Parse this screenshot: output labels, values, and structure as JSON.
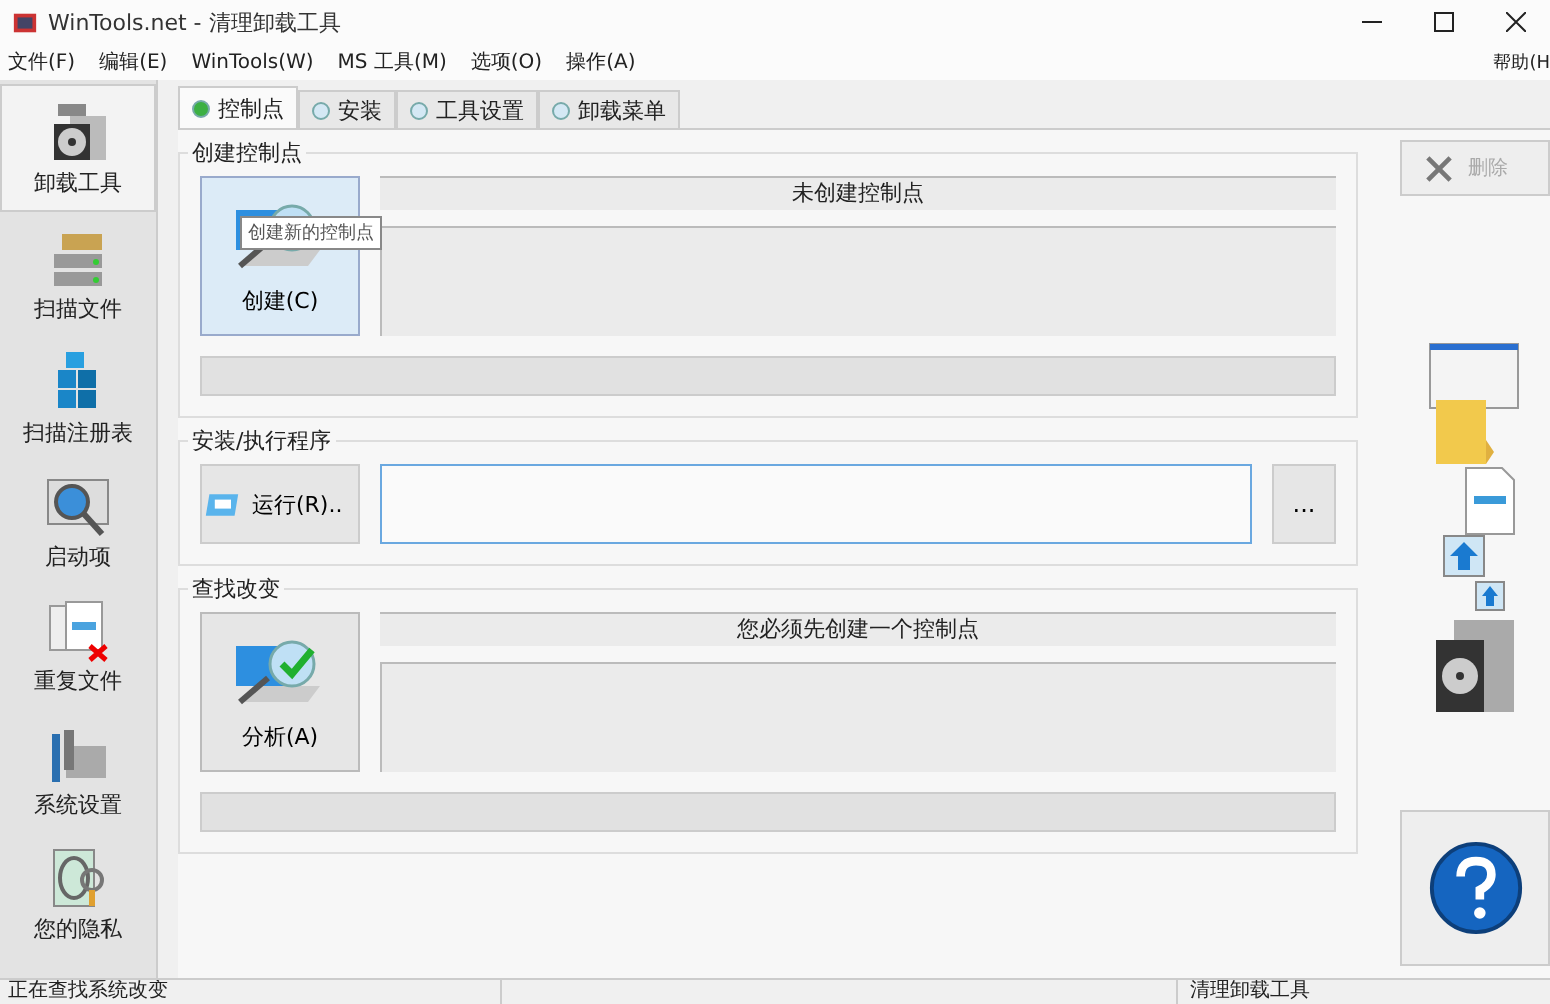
{
  "window": {
    "title": "WinTools.net - 清理卸载工具"
  },
  "menu": [
    {
      "label": "文件(F)"
    },
    {
      "label": "编辑(E)"
    },
    {
      "label": "WinTools(W)"
    },
    {
      "label": "MS 工具(M)"
    },
    {
      "label": "选项(O)"
    },
    {
      "label": "操作(A)"
    }
  ],
  "help_menu": "帮助(H",
  "tabs": [
    {
      "label": "控制点",
      "selected": true
    },
    {
      "label": "安装",
      "selected": false
    },
    {
      "label": "工具设置",
      "selected": false
    },
    {
      "label": "卸载菜单",
      "selected": false
    }
  ],
  "sidebar": {
    "items": [
      {
        "label": "卸载工具",
        "selected": true
      },
      {
        "label": "扫描文件",
        "selected": false
      },
      {
        "label": "扫描注册表",
        "selected": false
      },
      {
        "label": "启动项",
        "selected": false
      },
      {
        "label": "重复文件",
        "selected": false
      },
      {
        "label": "系统设置",
        "selected": false
      },
      {
        "label": "您的隐私",
        "selected": false
      }
    ]
  },
  "sections": [
    {
      "kind": "status",
      "title": "创建控制点",
      "button": "创建(C)",
      "highlighted": true,
      "check": false,
      "status": "未创建控制点",
      "tooltip": "创建新的控制点",
      "progress": {
        "level": 0
      }
    },
    {
      "kind": "run",
      "title": "安装/执行程序",
      "button": "运行(R)..",
      "focused": true,
      "browse": "..."
    },
    {
      "kind": "status",
      "title": "查找改变",
      "button": "分析(A)",
      "highlighted": false,
      "check": true,
      "status": "您必须先创建一个控制点",
      "progress": {
        "level": 0
      }
    }
  ],
  "delete_button": {
    "label": "删除",
    "disabled": true
  },
  "status_bar": [
    {
      "text": "正在查找系统改变"
    },
    {
      "text": "清理卸载工具"
    }
  ]
}
